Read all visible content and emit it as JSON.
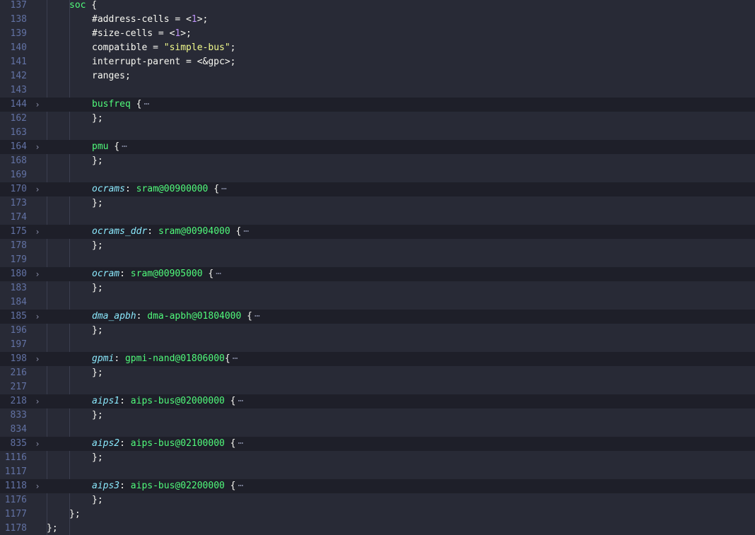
{
  "editor": {
    "lines": [
      {
        "num": "137",
        "indent": 1,
        "fold": false,
        "tokens": [
          {
            "t": "soc",
            "c": "node"
          },
          {
            "t": " {",
            "c": "plain"
          }
        ]
      },
      {
        "num": "138",
        "indent": 2,
        "fold": false,
        "tokens": [
          {
            "t": "#address-cells = <",
            "c": "plain"
          },
          {
            "t": "1",
            "c": "num"
          },
          {
            "t": ">;",
            "c": "plain"
          }
        ]
      },
      {
        "num": "139",
        "indent": 2,
        "fold": false,
        "tokens": [
          {
            "t": "#size-cells = <",
            "c": "plain"
          },
          {
            "t": "1",
            "c": "num"
          },
          {
            "t": ">;",
            "c": "plain"
          }
        ]
      },
      {
        "num": "140",
        "indent": 2,
        "fold": false,
        "tokens": [
          {
            "t": "compatible = ",
            "c": "plain"
          },
          {
            "t": "\"simple-bus\"",
            "c": "str"
          },
          {
            "t": ";",
            "c": "plain"
          }
        ]
      },
      {
        "num": "141",
        "indent": 2,
        "fold": false,
        "tokens": [
          {
            "t": "interrupt-parent = <&gpc>;",
            "c": "plain"
          }
        ]
      },
      {
        "num": "142",
        "indent": 2,
        "fold": false,
        "tokens": [
          {
            "t": "ranges;",
            "c": "plain"
          }
        ]
      },
      {
        "num": "143",
        "indent": 0,
        "fold": false,
        "tokens": []
      },
      {
        "num": "144",
        "indent": 2,
        "fold": true,
        "tokens": [
          {
            "t": "busfreq",
            "c": "node"
          },
          {
            "t": " {",
            "c": "plain"
          }
        ]
      },
      {
        "num": "162",
        "indent": 2,
        "fold": false,
        "tokens": [
          {
            "t": "};",
            "c": "plain"
          }
        ]
      },
      {
        "num": "163",
        "indent": 0,
        "fold": false,
        "tokens": []
      },
      {
        "num": "164",
        "indent": 2,
        "fold": true,
        "tokens": [
          {
            "t": "pmu",
            "c": "node"
          },
          {
            "t": " {",
            "c": "plain"
          }
        ]
      },
      {
        "num": "168",
        "indent": 2,
        "fold": false,
        "tokens": [
          {
            "t": "};",
            "c": "plain"
          }
        ]
      },
      {
        "num": "169",
        "indent": 0,
        "fold": false,
        "tokens": []
      },
      {
        "num": "170",
        "indent": 2,
        "fold": true,
        "tokens": [
          {
            "t": "ocrams",
            "c": "label"
          },
          {
            "t": ": ",
            "c": "plain"
          },
          {
            "t": "sram@00900000",
            "c": "node"
          },
          {
            "t": " {",
            "c": "plain"
          }
        ]
      },
      {
        "num": "173",
        "indent": 2,
        "fold": false,
        "tokens": [
          {
            "t": "};",
            "c": "plain"
          }
        ]
      },
      {
        "num": "174",
        "indent": 0,
        "fold": false,
        "tokens": []
      },
      {
        "num": "175",
        "indent": 2,
        "fold": true,
        "tokens": [
          {
            "t": "ocrams_ddr",
            "c": "label"
          },
          {
            "t": ": ",
            "c": "plain"
          },
          {
            "t": "sram@00904000",
            "c": "node"
          },
          {
            "t": " {",
            "c": "plain"
          }
        ]
      },
      {
        "num": "178",
        "indent": 2,
        "fold": false,
        "tokens": [
          {
            "t": "};",
            "c": "plain"
          }
        ]
      },
      {
        "num": "179",
        "indent": 0,
        "fold": false,
        "tokens": []
      },
      {
        "num": "180",
        "indent": 2,
        "fold": true,
        "tokens": [
          {
            "t": "ocram",
            "c": "label"
          },
          {
            "t": ": ",
            "c": "plain"
          },
          {
            "t": "sram@00905000",
            "c": "node"
          },
          {
            "t": " {",
            "c": "plain"
          }
        ]
      },
      {
        "num": "183",
        "indent": 2,
        "fold": false,
        "tokens": [
          {
            "t": "};",
            "c": "plain"
          }
        ]
      },
      {
        "num": "184",
        "indent": 0,
        "fold": false,
        "tokens": []
      },
      {
        "num": "185",
        "indent": 2,
        "fold": true,
        "tokens": [
          {
            "t": "dma_apbh",
            "c": "label"
          },
          {
            "t": ": ",
            "c": "plain"
          },
          {
            "t": "dma-apbh@01804000",
            "c": "node"
          },
          {
            "t": " {",
            "c": "plain"
          }
        ]
      },
      {
        "num": "196",
        "indent": 2,
        "fold": false,
        "tokens": [
          {
            "t": "};",
            "c": "plain"
          }
        ]
      },
      {
        "num": "197",
        "indent": 0,
        "fold": false,
        "tokens": []
      },
      {
        "num": "198",
        "indent": 2,
        "fold": true,
        "tokens": [
          {
            "t": "gpmi",
            "c": "label"
          },
          {
            "t": ": ",
            "c": "plain"
          },
          {
            "t": "gpmi-nand@01806000",
            "c": "node"
          },
          {
            "t": "{",
            "c": "plain"
          }
        ]
      },
      {
        "num": "216",
        "indent": 2,
        "fold": false,
        "tokens": [
          {
            "t": "};",
            "c": "plain"
          }
        ]
      },
      {
        "num": "217",
        "indent": 0,
        "fold": false,
        "tokens": []
      },
      {
        "num": "218",
        "indent": 2,
        "fold": true,
        "tokens": [
          {
            "t": "aips1",
            "c": "label"
          },
          {
            "t": ": ",
            "c": "plain"
          },
          {
            "t": "aips-bus@02000000",
            "c": "node"
          },
          {
            "t": " {",
            "c": "plain"
          }
        ]
      },
      {
        "num": "833",
        "indent": 2,
        "fold": false,
        "tokens": [
          {
            "t": "};",
            "c": "plain"
          }
        ]
      },
      {
        "num": "834",
        "indent": 0,
        "fold": false,
        "tokens": []
      },
      {
        "num": "835",
        "indent": 2,
        "fold": true,
        "tokens": [
          {
            "t": "aips2",
            "c": "label"
          },
          {
            "t": ": ",
            "c": "plain"
          },
          {
            "t": "aips-bus@02100000",
            "c": "node"
          },
          {
            "t": " {",
            "c": "plain"
          }
        ]
      },
      {
        "num": "1116",
        "indent": 2,
        "fold": false,
        "tokens": [
          {
            "t": "};",
            "c": "plain"
          }
        ]
      },
      {
        "num": "1117",
        "indent": 0,
        "fold": false,
        "tokens": []
      },
      {
        "num": "1118",
        "indent": 2,
        "fold": true,
        "tokens": [
          {
            "t": "aips3",
            "c": "label"
          },
          {
            "t": ": ",
            "c": "plain"
          },
          {
            "t": "aips-bus@02200000",
            "c": "node"
          },
          {
            "t": " {",
            "c": "plain"
          }
        ]
      },
      {
        "num": "1176",
        "indent": 2,
        "fold": false,
        "tokens": [
          {
            "t": "};",
            "c": "plain"
          }
        ]
      },
      {
        "num": "1177",
        "indent": 1,
        "fold": false,
        "tokens": [
          {
            "t": "};",
            "c": "plain"
          }
        ]
      },
      {
        "num": "1178",
        "indent": 0,
        "fold": false,
        "tokens": [
          {
            "t": "};",
            "c": "plain"
          }
        ]
      }
    ],
    "fold_icon": "chevron-right-icon",
    "fold_glyph": "›",
    "ellipsis": "⋯",
    "colors": {
      "background": "#282a36",
      "folded_line": "#1e1f29",
      "line_number": "#6272a4",
      "node": "#50fa7b",
      "label": "#8be9fd",
      "string": "#f1fa8c",
      "number": "#bd93f9",
      "plain": "#f8f8f2"
    }
  }
}
